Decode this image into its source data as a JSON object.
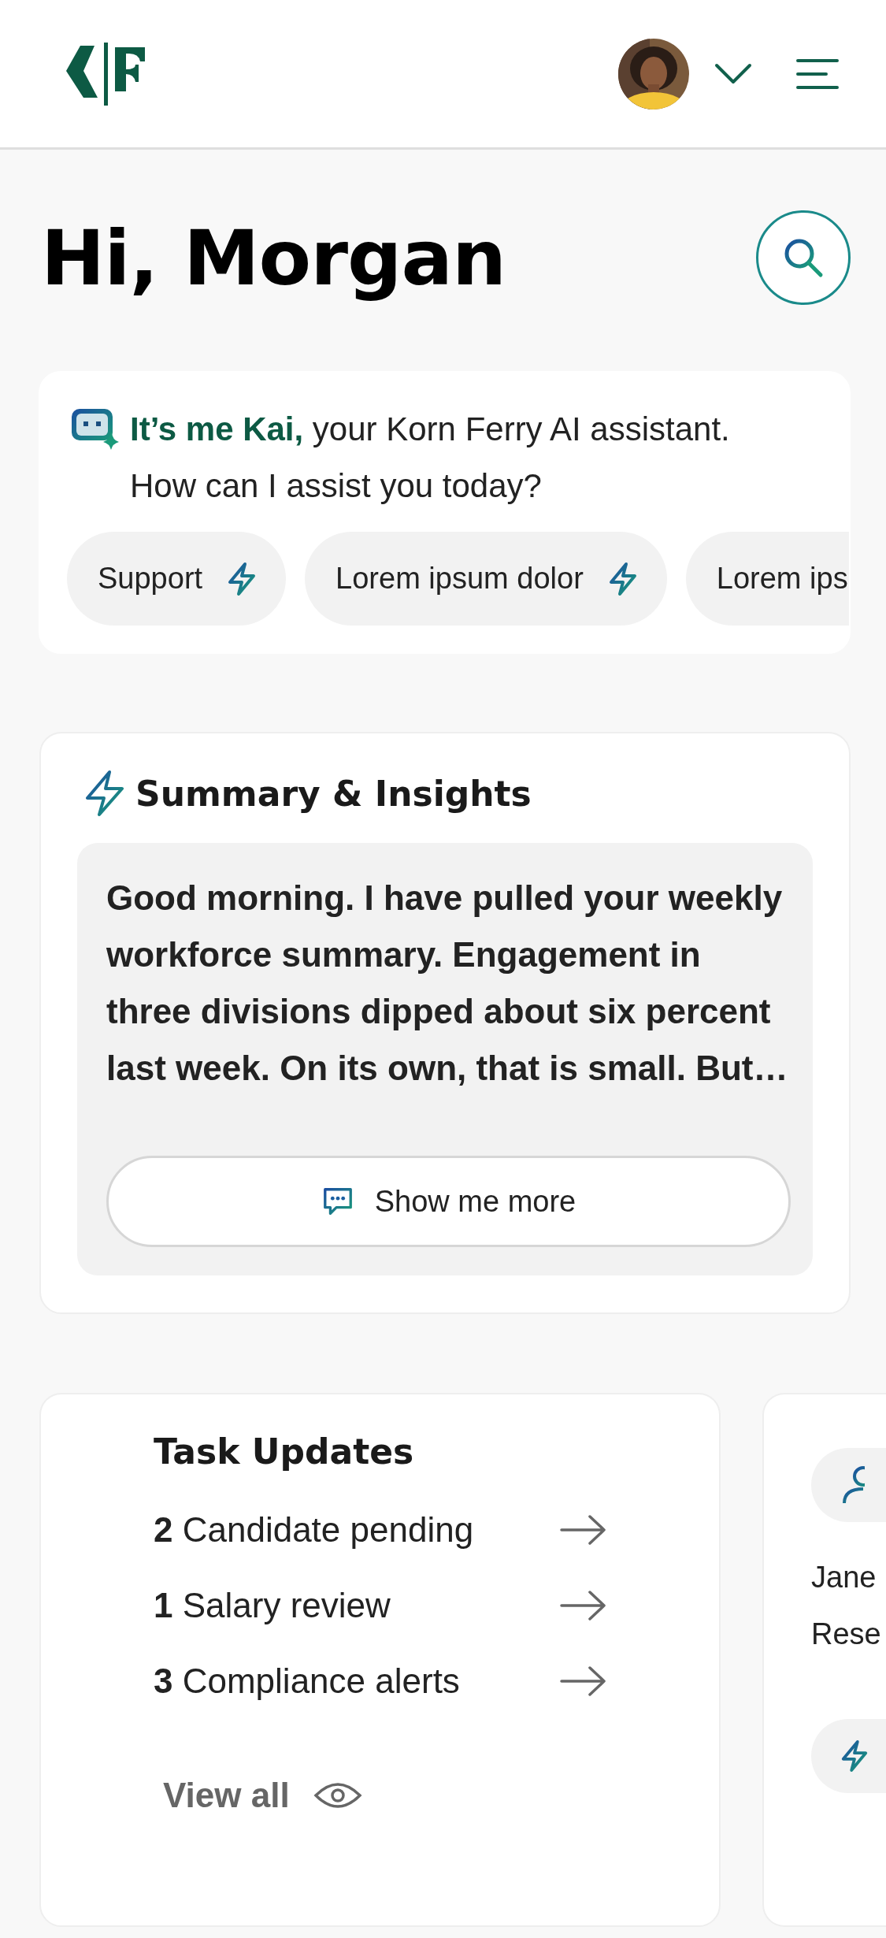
{
  "greeting": "Hi, Morgan",
  "assistant": {
    "name": "It’s me Kai,",
    "intro": "your Korn Ferry AI assistant.",
    "question": "How can I assist you today?",
    "chips": [
      {
        "label": "Support",
        "icon": true,
        "cut": false
      },
      {
        "label": "Lorem ipsum dolor",
        "icon": true,
        "cut": false
      },
      {
        "label": "Lorem ips",
        "icon": false,
        "cut": true
      }
    ]
  },
  "summary": {
    "title": "Summary & Insights",
    "text": "Good morning. I have pulled your weekly workforce summary. Engagement in three divisions dipped about six percent last week. On its own, that is small. But…",
    "button": "Show me more"
  },
  "tasks": {
    "title": "Task Updates",
    "items": [
      {
        "count": "2",
        "label": "Candidate pending"
      },
      {
        "count": "1",
        "label": "Salary review"
      },
      {
        "count": "3",
        "label": "Compliance alerts"
      }
    ],
    "link": "View all"
  },
  "contact": {
    "name": "Jane",
    "role": "Rese"
  }
}
